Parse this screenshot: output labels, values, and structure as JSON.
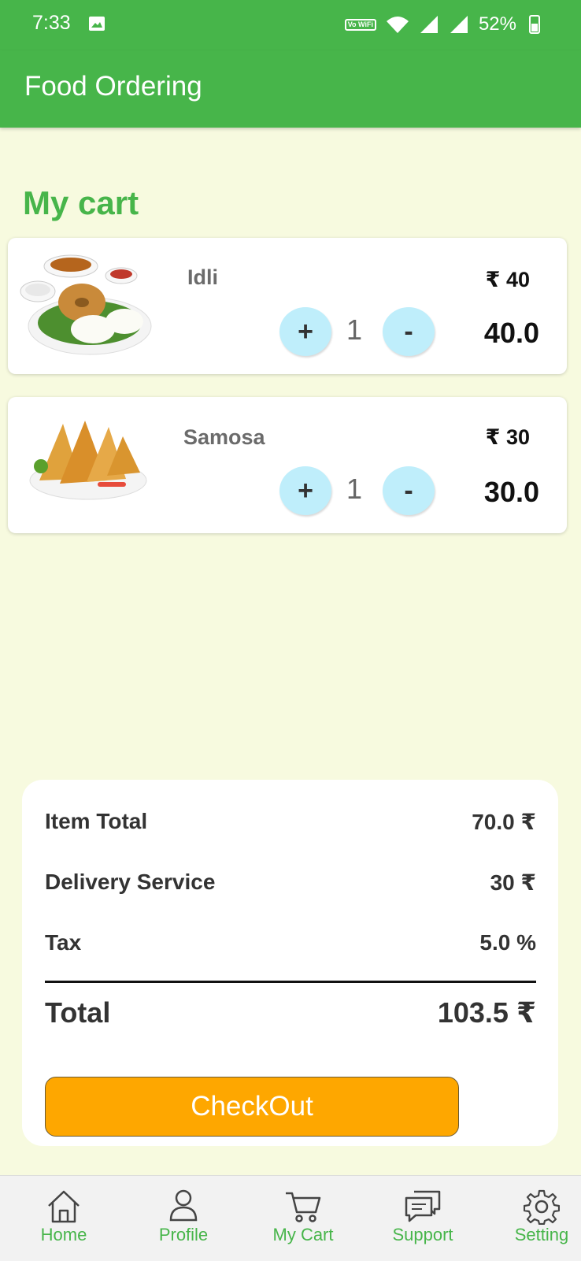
{
  "status_bar": {
    "time": "7:33",
    "volte_label": "Vo WiFi",
    "battery": "52%"
  },
  "app_bar": {
    "title": "Food Ordering"
  },
  "cart": {
    "heading": "My cart",
    "items": [
      {
        "name": "Idli",
        "price": "₹ 40",
        "quantity": "1",
        "subtotal": "40.0",
        "plus": "+",
        "minus": "-"
      },
      {
        "name": "Samosa",
        "price": "₹ 30",
        "quantity": "1",
        "subtotal": "30.0",
        "plus": "+",
        "minus": "-"
      }
    ]
  },
  "summary": {
    "item_total_label": "Item Total",
    "item_total_value": "70.0 ₹",
    "delivery_label": "Delivery Service",
    "delivery_value": "30 ₹",
    "tax_label": "Tax",
    "tax_value": "5.0 %",
    "total_label": "Total",
    "total_value": "103.5 ₹",
    "checkout_label": "CheckOut"
  },
  "bottom_nav": {
    "items": [
      {
        "label": "Home",
        "icon": "home-icon"
      },
      {
        "label": "Profile",
        "icon": "profile-icon"
      },
      {
        "label": "My Cart",
        "icon": "cart-icon"
      },
      {
        "label": "Support",
        "icon": "chat-icon"
      },
      {
        "label": "Setting",
        "icon": "gear-icon"
      }
    ]
  },
  "colors": {
    "primary": "#47b54a",
    "background": "#f7fadf",
    "qty_button": "#bfeefb",
    "checkout": "#fea700"
  }
}
